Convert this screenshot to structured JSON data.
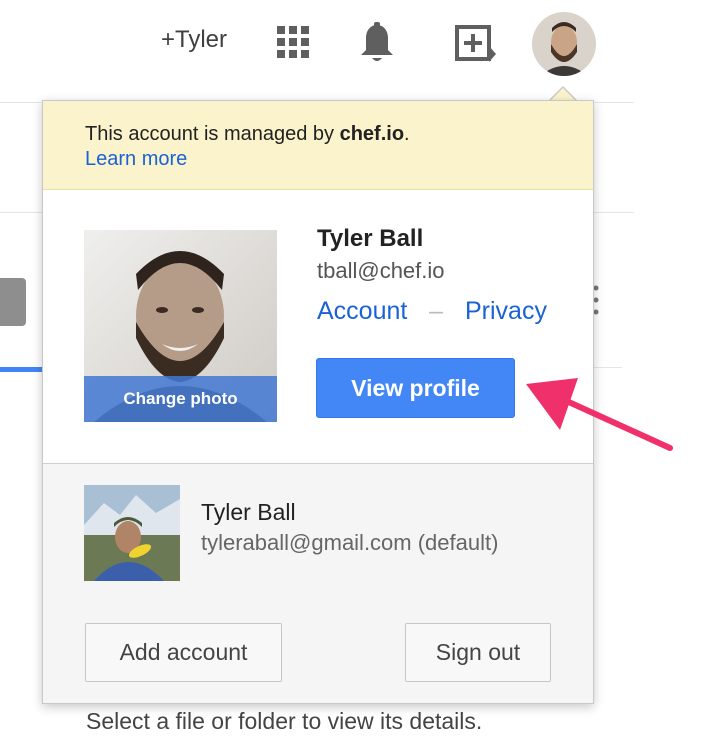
{
  "topbar": {
    "user_link": "+Tyler",
    "icons": [
      "apps-grid-icon",
      "notifications-bell-icon",
      "share-add-icon",
      "account-avatar"
    ]
  },
  "popup": {
    "notice": {
      "text_prefix": "This account is managed by ",
      "domain": "chef.io",
      "text_suffix": ".",
      "learn_more": "Learn more"
    },
    "current_account": {
      "change_photo": "Change photo",
      "name": "Tyler Ball",
      "email": "tball@chef.io",
      "account_link": "Account",
      "separator": "–",
      "privacy_link": "Privacy",
      "view_profile": "View profile"
    },
    "other_account": {
      "name": "Tyler Ball",
      "email": "tyleraball@gmail.com (default)"
    },
    "footer": {
      "add_account": "Add account",
      "sign_out": "Sign out"
    }
  },
  "background": {
    "status_text": "Select a file or folder to view its details."
  },
  "colors": {
    "link_blue": "#1a62d6",
    "primary_button": "#4287f5",
    "notice_bg": "#fbf3cc",
    "annotation_arrow": "#f0306a"
  }
}
